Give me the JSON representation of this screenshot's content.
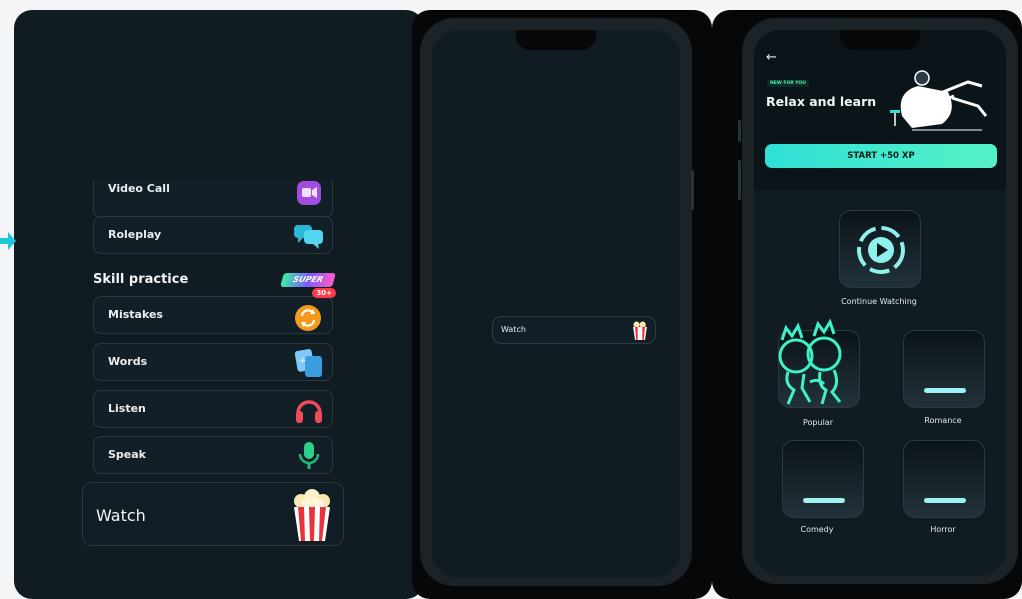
{
  "left_panel": {
    "items_top": [
      {
        "label": "Video Call",
        "icon": "video-call-icon"
      },
      {
        "label": "Roleplay",
        "icon": "chat-bubbles-icon"
      }
    ],
    "section_title": "Skill practice",
    "super_badge": "SUPER",
    "skill_items": [
      {
        "label": "Mistakes",
        "icon": "repeat-icon",
        "badge": "30+"
      },
      {
        "label": "Words",
        "icon": "flashcards-icon"
      },
      {
        "label": "Listen",
        "icon": "headphones-icon"
      },
      {
        "label": "Speak",
        "icon": "microphone-icon"
      }
    ],
    "watch_label": "Watch"
  },
  "middle_phone": {
    "watch_label": "Watch"
  },
  "right_phone": {
    "tag": "NEW FOR YOU",
    "title": "Relax and learn",
    "start_button": "START +50 XP",
    "continue_label": "Continue Watching",
    "categories": [
      {
        "label": "Popular"
      },
      {
        "label": "Romance"
      },
      {
        "label": "Comedy"
      },
      {
        "label": "Horror"
      }
    ]
  },
  "colors": {
    "background": "#111c22",
    "accent": "#2fe0d6",
    "card_border": "#2b3840"
  }
}
